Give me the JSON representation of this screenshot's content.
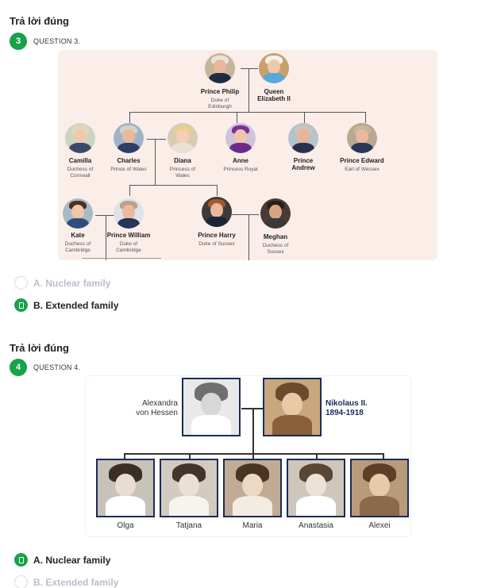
{
  "q3": {
    "heading": "Trả lời đúng",
    "number": "3",
    "label": "QUESTION 3.",
    "tree": {
      "philip": {
        "name": "Prince Philip",
        "title": "Duke of\nEdinburgh"
      },
      "elizabeth": {
        "name": "Queen\nElizabeth II",
        "title": ""
      },
      "camilla": {
        "name": "Camilla",
        "title": "Duchess of\nCornwall"
      },
      "charles": {
        "name": "Charles",
        "title": "Prince of Wales"
      },
      "diana": {
        "name": "Diana",
        "title": "Princess of\nWales"
      },
      "anne": {
        "name": "Anne",
        "title": "Princess Royal"
      },
      "andrew": {
        "name": "Prince\nAndrew",
        "title": ""
      },
      "edward": {
        "name": "Prince Edward",
        "title": "Earl of Wessex"
      },
      "kate": {
        "name": "Kate",
        "title": "Duchess of\nCambridge"
      },
      "william": {
        "name": "Prince William",
        "title": "Duke of\nCambridge"
      },
      "harry": {
        "name": "Prince Harry",
        "title": "Duke of Sussex"
      },
      "meghan": {
        "name": "Meghan",
        "title": "Duchess of\nSussex"
      }
    },
    "options": [
      {
        "text": "A. Nuclear family",
        "selected": false
      },
      {
        "text": "B. Extended family",
        "selected": true
      }
    ]
  },
  "q4": {
    "heading": "Trả lời đúng",
    "number": "4",
    "label": "QUESTION 4.",
    "parents": {
      "mother": "Alexandra\nvon Hessen",
      "father": "Nikolaus II.\n1894-1918"
    },
    "children": [
      "Olga",
      "Tatjana",
      "Maria",
      "Anastasia",
      "Alexei"
    ],
    "options": [
      {
        "text": "A. Nuclear family",
        "selected": true
      },
      {
        "text": "B. Extended family",
        "selected": false
      }
    ]
  },
  "colors": {
    "accent": "#16a34a",
    "muted_option": "#b8bec8",
    "panel_bg": "#fbeee9",
    "frame": "#1a2b5c"
  }
}
